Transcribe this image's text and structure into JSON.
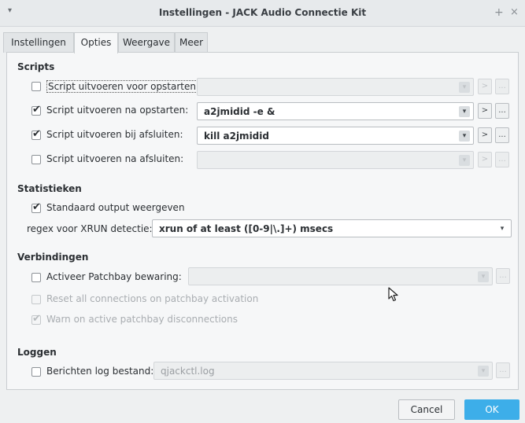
{
  "window": {
    "title": "Instellingen - JACK Audio Connectie Kit",
    "menu_glyph": "▾",
    "plus_glyph": "+",
    "close_glyph": "×"
  },
  "tabs": [
    {
      "label": "Instellingen",
      "active": false
    },
    {
      "label": "Opties",
      "active": true
    },
    {
      "label": "Weergave",
      "active": false
    },
    {
      "label": "Meer",
      "active": false
    }
  ],
  "scripts": {
    "heading": "Scripts",
    "rows": [
      {
        "label": "Script uitvoeren voor opstarten:",
        "checked": false,
        "value": ""
      },
      {
        "label": "Script uitvoeren na opstarten:",
        "checked": true,
        "value": "a2jmidid -e &"
      },
      {
        "label": "Script uitvoeren bij afsluiten:",
        "checked": true,
        "value": "kill a2jmidid"
      },
      {
        "label": "Script uitvoeren na afsluiten:",
        "checked": false,
        "value": ""
      }
    ]
  },
  "statistieken": {
    "heading": "Statistieken",
    "stdout_label": "Standaard output weergeven",
    "stdout_checked": true,
    "regex_label": "regex voor XRUN detectie:",
    "regex_value": "xrun of at least ([0-9|\\.]+) msecs"
  },
  "verbindingen": {
    "heading": "Verbindingen",
    "patchbay_label": "Activeer Patchbay bewaring:",
    "patchbay_checked": false,
    "patchbay_value": "",
    "reset_label": "Reset all connections on patchbay activation",
    "warn_label": "Warn on active patchbay disconnections"
  },
  "loggen": {
    "heading": "Loggen",
    "log_label": "Berichten log bestand:",
    "log_checked": false,
    "log_value": "qjackctl.log"
  },
  "buttons": {
    "cancel": "Cancel",
    "ok": "OK"
  },
  "glyphs": {
    "arrow": "▾",
    "run": ">",
    "browse": "..."
  },
  "colors": {
    "accent": "#3daee9",
    "background": "#eef0f1",
    "panel": "#f6f7f8"
  }
}
